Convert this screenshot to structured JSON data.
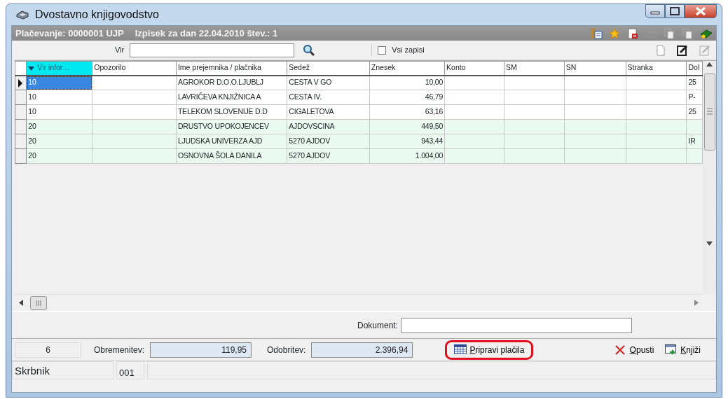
{
  "window": {
    "title": "Dvostavno knjigovodstvo"
  },
  "header": {
    "title": "Plačevanje: 0000001 UJP",
    "subtitle": "Izpisek za dan 22.04.2010 štev.: 1"
  },
  "filter": {
    "label": "Vir",
    "all_records": {
      "label": "Vsi zapisi",
      "checked": false
    }
  },
  "table": {
    "columns": [
      {
        "label": "Vir infor…",
        "sorted": true
      },
      {
        "label": "Opozorilo",
        "sorted": false
      },
      {
        "label": "Ime prejemnika / plačnika",
        "sorted": false
      },
      {
        "label": "Sedež",
        "sorted": false
      },
      {
        "label": "Znesek",
        "sorted": false
      },
      {
        "label": "Konto",
        "sorted": false
      },
      {
        "label": "SM",
        "sorted": false
      },
      {
        "label": "SN",
        "sorted": false
      },
      {
        "label": "Stranka",
        "sorted": false
      },
      {
        "label": "Dol",
        "sorted": false
      }
    ],
    "rows": [
      {
        "selected": true,
        "color": "#ffffff",
        "cells": [
          "10",
          "",
          "AGROKOR D.O.O.LJUBLJ",
          "CESTA V GO",
          "10,00",
          "",
          "",
          "",
          "",
          "25"
        ]
      },
      {
        "selected": false,
        "color": "#ffffff",
        "cells": [
          "10",
          "",
          "LAVRIČEVA KNJIŽNICA A",
          "CESTA IV.",
          "46,79",
          "",
          "",
          "",
          "",
          "P-"
        ]
      },
      {
        "selected": false,
        "color": "#ffffff",
        "cells": [
          "10",
          "",
          "TELEKOM SLOVENIJE D.D",
          "CIGALETOVA",
          "63,16",
          "",
          "",
          "",
          "",
          "25"
        ]
      },
      {
        "selected": false,
        "color": "#eafaf0",
        "cells": [
          "20",
          "",
          "DRUSTVO UPOKOJENCEV",
          "AJDOVSCINA",
          "449,50",
          "",
          "",
          "",
          "",
          ""
        ]
      },
      {
        "selected": false,
        "color": "#eafaf0",
        "cells": [
          "20",
          "",
          "LJUDSKA UNIVERZA AJD",
          "5270 AJDOV",
          "943,44",
          "",
          "",
          "",
          "",
          "IR"
        ]
      },
      {
        "selected": false,
        "color": "#eafaf0",
        "cells": [
          "20",
          "",
          "OSNOVNA ŠOLA DANILA",
          "5270 AJDOV",
          "1.004,00",
          "",
          "",
          "",
          "",
          ""
        ]
      }
    ]
  },
  "document": {
    "label": "Dokument:"
  },
  "totals": {
    "count": "6",
    "debit_label": "Obremenitev:",
    "debit": "119,95",
    "credit_label": "Odobritev:",
    "credit": "2.396,94"
  },
  "buttons": [
    {
      "kind": "prepare",
      "label": "Pripravi plačila",
      "highlighted": true
    },
    {
      "kind": "cancel",
      "label": "Opusti",
      "highlighted": false
    },
    {
      "kind": "post",
      "label": "Knjiži",
      "highlighted": false
    }
  ],
  "status_bar": [
    "Skrbnik",
    "001"
  ]
}
